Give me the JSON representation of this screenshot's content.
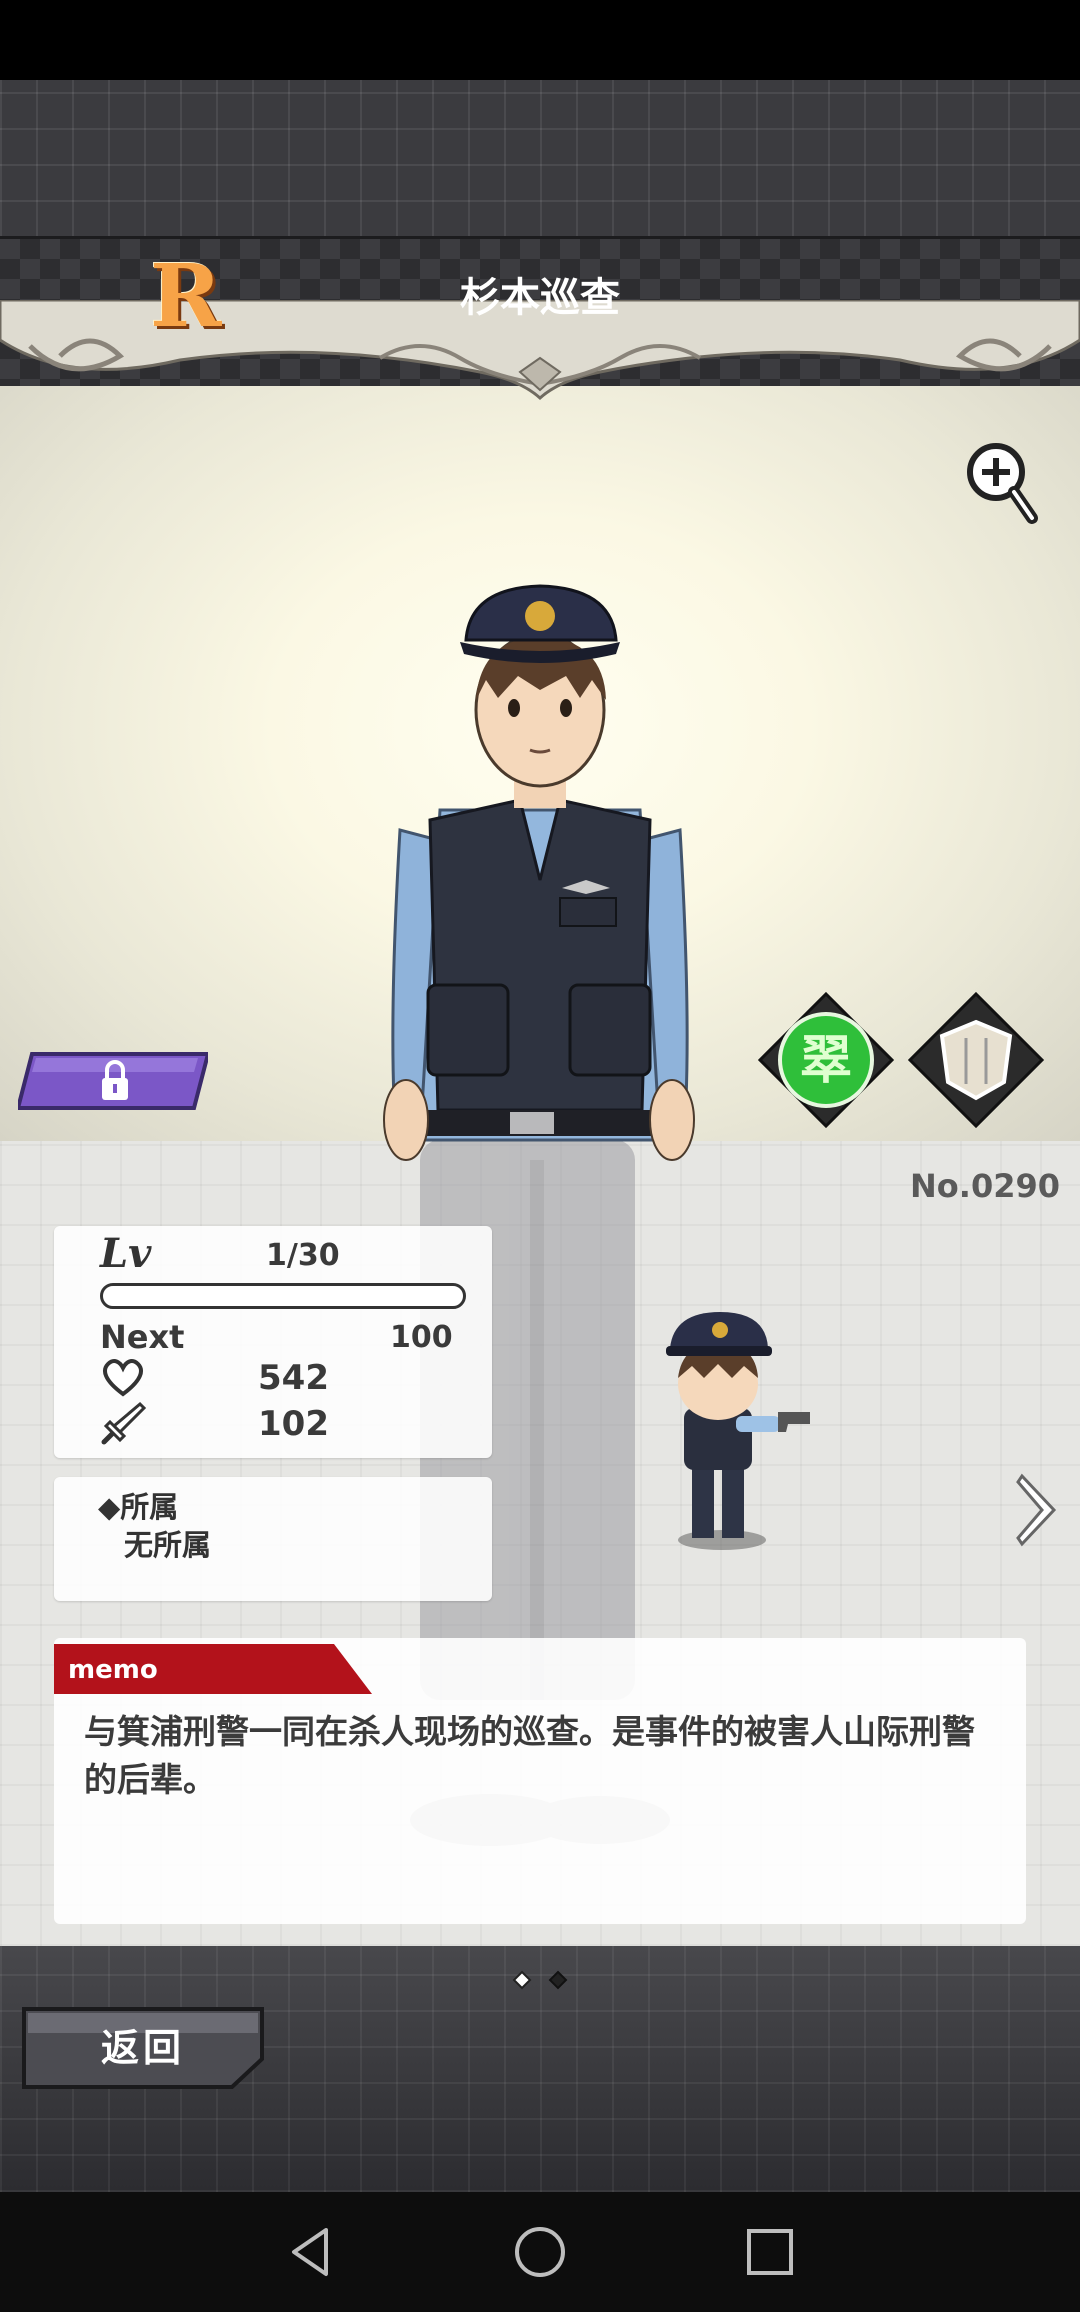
{
  "card": {
    "rarity": "R",
    "name": "杉本巡查",
    "number": "No.0290"
  },
  "stats": {
    "lv_label": "Lv",
    "lv_value": "1/30",
    "xp_fraction": 0.0,
    "next_label": "Next",
    "next_value": "100",
    "hp_value": "542",
    "atk_value": "102"
  },
  "affiliation": {
    "label": "◆所属",
    "value": "无所属"
  },
  "memo": {
    "tag": "memo",
    "text": "与箕浦刑警一同在杀人现场的巡查。是事件的被害人山际刑警的后辈。"
  },
  "attribute_icon": {
    "glyph": "翠"
  },
  "pagination": {
    "total": 2,
    "current": 1
  },
  "buttons": {
    "back": "返回"
  },
  "colors": {
    "rarity": "#f7a347",
    "lock_button": "#7b57c7",
    "attribute": "#2fbf3a",
    "memo_tag": "#b3121b"
  }
}
